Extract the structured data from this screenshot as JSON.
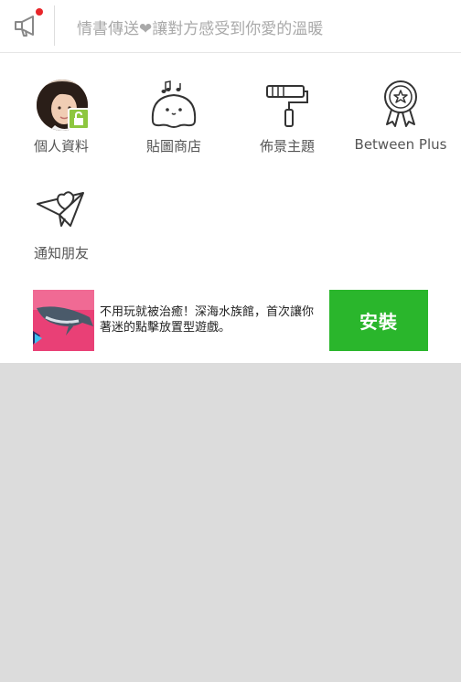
{
  "announcement": {
    "text": "情書傳送❤讓對方感受到你愛的溫暖"
  },
  "menu": [
    {
      "label": "個人資料",
      "icon": "profile-avatar"
    },
    {
      "label": "貼圖商店",
      "icon": "sticker-shop-icon"
    },
    {
      "label": "佈景主題",
      "icon": "paint-roller-icon"
    },
    {
      "label": "Between Plus",
      "icon": "award-badge-icon"
    },
    {
      "label": "通知朋友",
      "icon": "paper-plane-heart-icon"
    }
  ],
  "ad": {
    "text": "不用玩就被治癒！深海水族館，首次讓你著迷的點擊放置型遊戲。",
    "button_label": "安裝"
  },
  "colors": {
    "accent_red": "#e8262a",
    "install_green": "#2ab62c",
    "profile_badge": "#8dc63f"
  }
}
